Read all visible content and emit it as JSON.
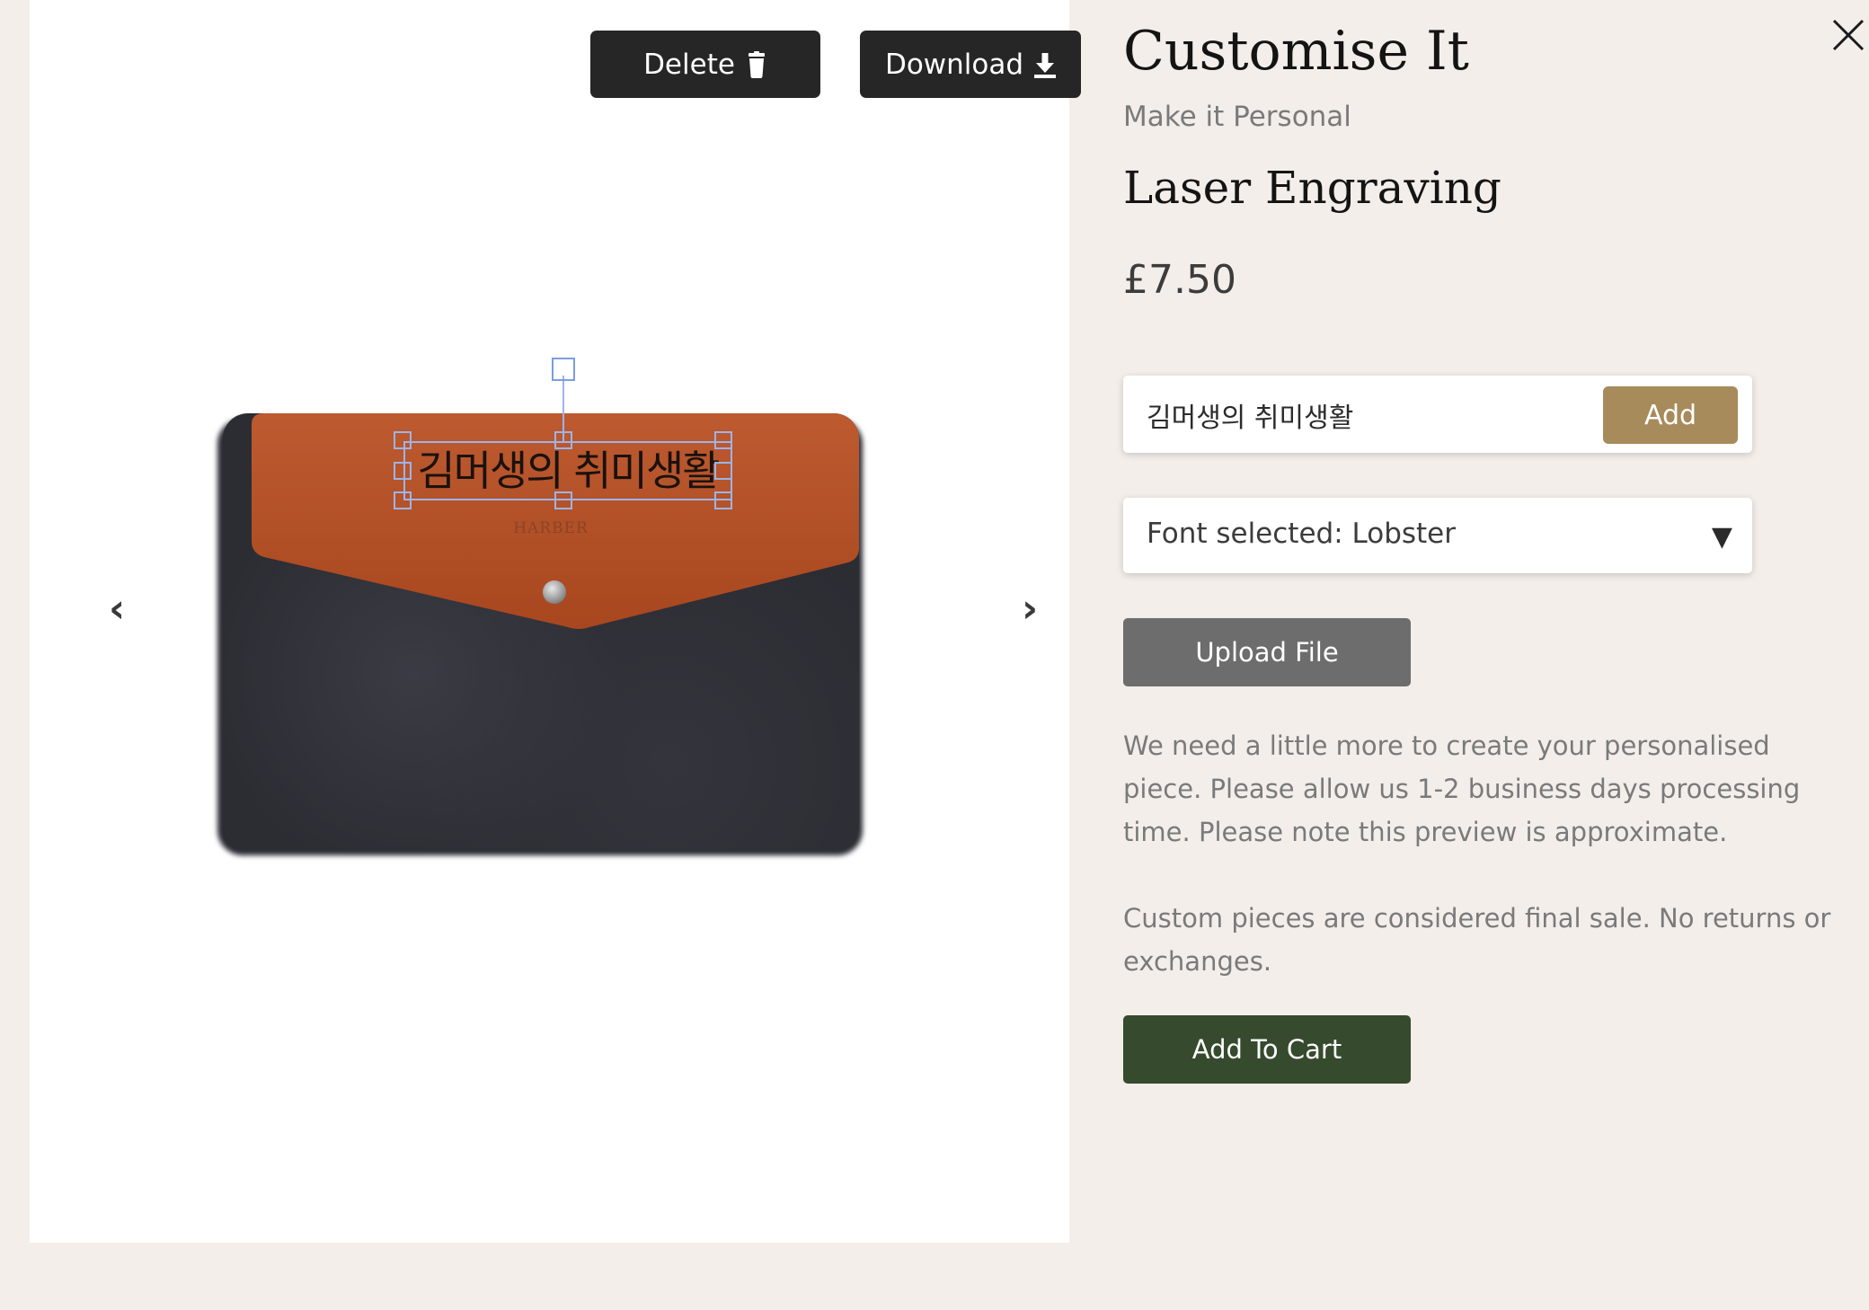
{
  "canvas": {
    "delete_label": "Delete",
    "download_label": "Download",
    "prev_arrow": "‹",
    "next_arrow": "›",
    "engraving_text": "김머생의 취미생활",
    "product_brand": "HARBER",
    "colors": {
      "flap": "#b9532b",
      "felt": "#2c2c33",
      "selection": "#9db4e6"
    }
  },
  "panel": {
    "title": "Customise It",
    "subtitle": "Make it Personal",
    "section_title": "Laser Engraving",
    "price": "£7.50",
    "text_input_value": "김머생의 취미생활",
    "add_label": "Add",
    "font_select_label": "Font selected: Lobster",
    "font_select_caret": "▼",
    "upload_label": "Upload File",
    "notice_1": "We need a little more to create your personalised piece. Please allow us 1-2 business days processing time. Please note this preview is approximate.",
    "notice_2": "Custom pieces are considered final sale. No returns or exchanges.",
    "add_to_cart_label": "Add To Cart",
    "colors": {
      "add_button": "#a88b5b",
      "upload_button": "#6d6d6d",
      "cart_button": "#364a2d",
      "background": "#f3eeea"
    }
  },
  "icons": {
    "delete": "trash-icon",
    "download": "download-icon",
    "close": "close-icon",
    "prev": "chevron-left-icon",
    "next": "chevron-right-icon",
    "dropdown": "caret-down-icon"
  }
}
